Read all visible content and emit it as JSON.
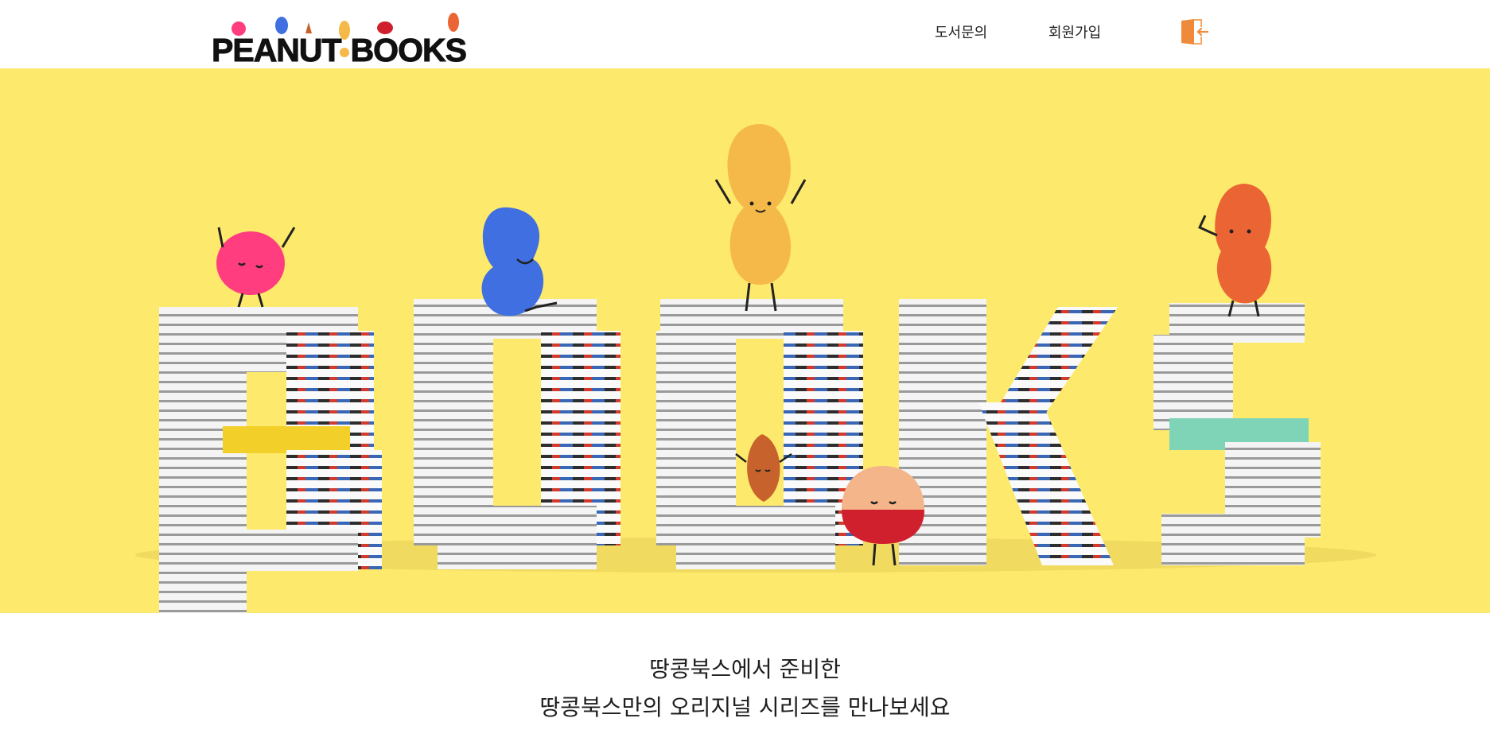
{
  "header": {
    "logo_text": "PEANUT BOOKS",
    "logo_left": "PEANUT",
    "logo_right": "BOOKS",
    "nav": [
      {
        "label": "도서문의"
      },
      {
        "label": "회원가입"
      }
    ],
    "login_icon": "door-exit-icon"
  },
  "hero": {
    "background_color": "#fde96b",
    "word": "BOOKS",
    "characters": [
      "pink-berry-icon",
      "blue-bean-icon",
      "peanut-icon",
      "almond-icon",
      "chestnut-icon",
      "orange-bean-icon"
    ]
  },
  "tagline": {
    "line1": "땅콩북스에서 준비한",
    "line2": "땅콩북스만의 오리지널 시리즈를 만나보세요"
  },
  "colors": {
    "accent": "#f08a3b",
    "hero_bg": "#fde96b"
  }
}
